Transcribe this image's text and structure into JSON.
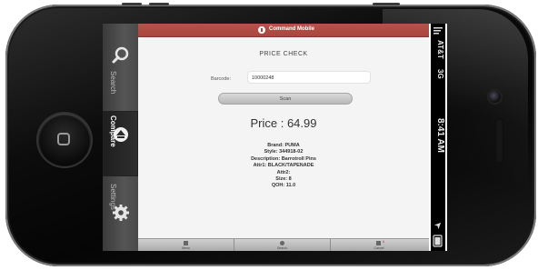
{
  "app": {
    "name": "Command Mobile",
    "page_title": "PRICE CHECK",
    "barcode": {
      "label": "Barcode:",
      "value": "10000248"
    },
    "scan_label": "Scan",
    "price_text": "Price : 64.99",
    "details": [
      "Brand: PUMA",
      "Style: 344918-02",
      "Description: Barrotroll Pins",
      "Attr1: BLACK/TAPENADE",
      "Attr2:",
      "Size: 8",
      "QOH: 11.0"
    ],
    "bottom_bar": [
      {
        "label": "Menu",
        "badge": ""
      },
      {
        "label": "Search",
        "badge": ""
      },
      {
        "label": "Cancel",
        "badge": "1"
      }
    ]
  },
  "tabs": [
    {
      "label": "Search",
      "icon": "search-icon",
      "active": false
    },
    {
      "label": "Compare",
      "icon": "compare-icon",
      "active": true
    },
    {
      "label": "Settings",
      "icon": "gear-icon",
      "active": false
    }
  ],
  "status_bar": {
    "carrier": "AT&T",
    "network": "3G",
    "time": "8:41 AM"
  },
  "colors": {
    "header_red": "#a9463d",
    "tabbar": "#4a4a4a",
    "phone_body": "#0c0c0c"
  }
}
